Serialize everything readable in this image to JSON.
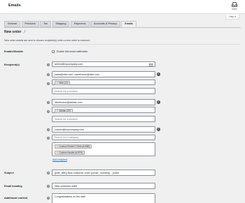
{
  "header": {
    "title": "Emails",
    "inbox_label": "Inbox"
  },
  "help_tab": {
    "label": "Help ▾"
  },
  "tabs": [
    {
      "label": "General"
    },
    {
      "label": "Products"
    },
    {
      "label": "Tax"
    },
    {
      "label": "Shipping"
    },
    {
      "label": "Payments"
    },
    {
      "label": "Accounts & Privacy"
    },
    {
      "label": "Emails",
      "active": true
    }
  ],
  "section": {
    "title": "New order",
    "up_link": "⤴",
    "description": "New order emails are sent to chosen recipient(s) when a new order is received."
  },
  "enable": {
    "label": "Enable/Disable",
    "checkbox_label": "Enable this email notification",
    "checked": true
  },
  "recipients": {
    "label": "Recipient(s)",
    "default_email": "admin@mycompany.com",
    "groups": [
      {
        "email": "sales@nike.com, warehouse@nike.com",
        "tags": [
          "Nike (17)"
        ],
        "search_placeholder": "Search for a product"
      },
      {
        "email": "distributors@adidas.com",
        "tags": [
          "Adidas (22)"
        ],
        "search_placeholder": "Search for a product"
      },
      {
        "email": "custom@mycompany.com",
        "search_placeholder": "Search for a category",
        "tags": [
          "Custom Printed T-Shirt (#1980)",
          "Custom Hoodie (#1974)"
        ]
      }
    ],
    "add_link": "Add recipient"
  },
  "subject": {
    "label": "Subject",
    "value": "[{site_title}] New customer order ({order_number}) - {order"
  },
  "heading": {
    "label": "Email heading",
    "value": "New customer order"
  },
  "additional": {
    "label": "Additional content",
    "value": "Congratulations on the sale."
  },
  "colors": {
    "accent": "#2271b1",
    "background": "#f0f0f1"
  }
}
